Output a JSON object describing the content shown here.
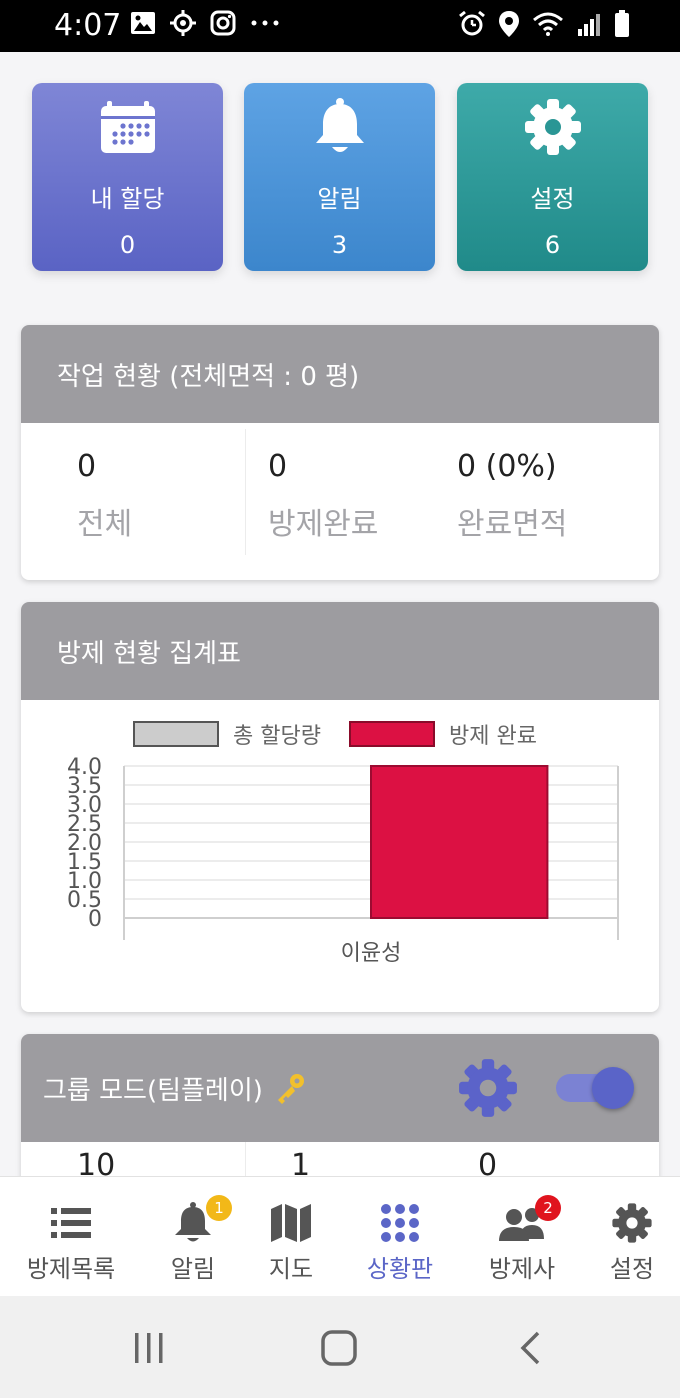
{
  "status_bar": {
    "time": "4:07"
  },
  "tiles": [
    {
      "label": "내 할당",
      "count": "0",
      "icon": "calendar-icon"
    },
    {
      "label": "알림",
      "count": "3",
      "icon": "bell-icon"
    },
    {
      "label": "설정",
      "count": "6",
      "icon": "gear-icon"
    }
  ],
  "work_status": {
    "title": "작업 현황 (전체면적 : 0 평)",
    "stats": [
      {
        "value": "0",
        "label": "전체"
      },
      {
        "value": "0",
        "label": "방제완료"
      },
      {
        "value": "0 (0%)",
        "label": "완료면적"
      }
    ]
  },
  "summary": {
    "title": "방제 현황 집계표",
    "legend": [
      {
        "label": "총 할당량",
        "color": "#cccccc"
      },
      {
        "label": "방제 완료",
        "color": "#dc1143"
      }
    ]
  },
  "chart_data": {
    "type": "bar",
    "categories": [
      "이윤성"
    ],
    "series": [
      {
        "name": "총 할당량",
        "values": [
          0
        ],
        "color": "#cccccc"
      },
      {
        "name": "방제 완료",
        "values": [
          4
        ],
        "color": "#dc1143"
      }
    ],
    "y_ticks": [
      "0",
      "0.5",
      "1.0",
      "1.5",
      "2.0",
      "2.5",
      "3.0",
      "3.5",
      "4.0"
    ],
    "ylim": [
      0,
      4
    ],
    "grid": true,
    "legend_position": "top"
  },
  "group_mode": {
    "title": "그룹 모드(팀플레이)",
    "toggle_on": true,
    "partial_values": [
      "10",
      "1",
      "0"
    ]
  },
  "tabbar": [
    {
      "label": "방제목록",
      "icon": "list-icon",
      "active": false,
      "badge": ""
    },
    {
      "label": "알림",
      "icon": "bell-icon",
      "active": false,
      "badge": "1",
      "badge_color": "#f2b818"
    },
    {
      "label": "지도",
      "icon": "map-icon",
      "active": false,
      "badge": ""
    },
    {
      "label": "상황판",
      "icon": "grid-dots-icon",
      "active": true,
      "badge": ""
    },
    {
      "label": "방제사",
      "icon": "users-icon",
      "active": false,
      "badge": "2",
      "badge_color": "#e0141e"
    },
    {
      "label": "설정",
      "icon": "gear-icon",
      "active": false,
      "badge": ""
    }
  ],
  "colors": {
    "accent": "#5b66c7",
    "header_gray": "#9d9ca0",
    "bar_red": "#dc1143"
  }
}
